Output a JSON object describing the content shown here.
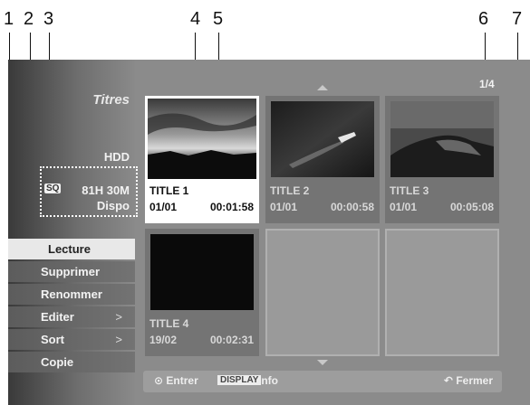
{
  "callouts": [
    "1",
    "2",
    "3",
    "4",
    "5",
    "6",
    "7"
  ],
  "sidebar": {
    "title": "Titres",
    "media": "HDD",
    "quality_badge": "SQ",
    "remaining_time": "81H 30M",
    "remaining_label": "Dispo",
    "menu": [
      {
        "label": "Lecture",
        "selected": true,
        "has_submenu": false
      },
      {
        "label": "Supprimer",
        "selected": false,
        "has_submenu": false
      },
      {
        "label": "Renommer",
        "selected": false,
        "has_submenu": false
      },
      {
        "label": "Editer",
        "selected": false,
        "has_submenu": true
      },
      {
        "label": "Sort",
        "selected": false,
        "has_submenu": true
      },
      {
        "label": "Copie",
        "selected": false,
        "has_submenu": false
      }
    ],
    "submenu_arrow": ">"
  },
  "grid": {
    "page_indicator": "1/4",
    "titles": [
      {
        "title": "TITLE 1",
        "date": "01/01",
        "duration": "00:01:58",
        "thumbnail": "sunset-sky",
        "selected": true
      },
      {
        "title": "TITLE 2",
        "date": "01/01",
        "duration": "00:00:58",
        "thumbnail": "boat-on-water",
        "selected": false
      },
      {
        "title": "TITLE 3",
        "date": "01/01",
        "duration": "00:05:08",
        "thumbnail": "rocky-coast",
        "selected": false
      },
      {
        "title": "TITLE 4",
        "date": "19/02",
        "duration": "00:02:31",
        "thumbnail": "black",
        "selected": false
      }
    ]
  },
  "bottom_bar": {
    "enter_icon": "circle-enter-icon",
    "enter_label": "Entrer",
    "display_badge": "DISPLAY",
    "info_label": "Info",
    "close_icon": "return-icon",
    "close_label": "Fermer"
  }
}
